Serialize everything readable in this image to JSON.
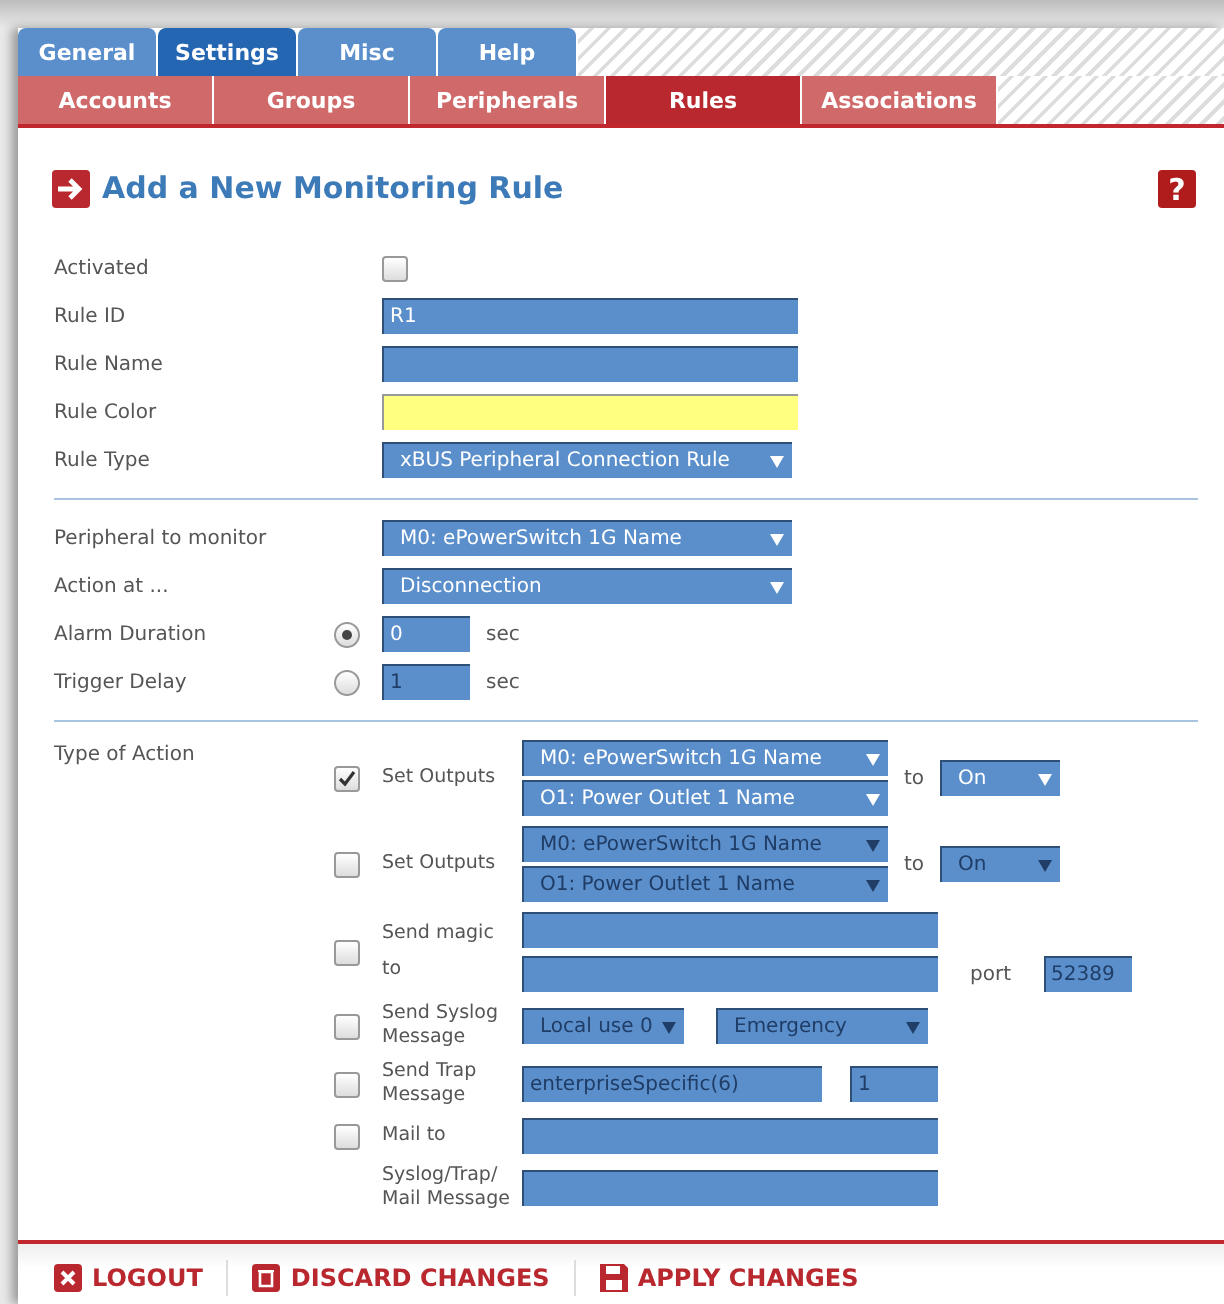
{
  "main_tabs": [
    {
      "label": "General",
      "selected": false
    },
    {
      "label": "Settings",
      "selected": true
    },
    {
      "label": "Misc",
      "selected": false
    },
    {
      "label": "Help",
      "selected": false
    }
  ],
  "sub_tabs": [
    {
      "label": "Accounts",
      "selected": false
    },
    {
      "label": "Groups",
      "selected": false
    },
    {
      "label": "Peripherals",
      "selected": false
    },
    {
      "label": "Rules",
      "selected": true
    },
    {
      "label": "Associations",
      "selected": false
    }
  ],
  "page": {
    "title": "Add a New Monitoring Rule",
    "help": "?"
  },
  "rule_fields": [
    {
      "kind": "checkbox",
      "label": "Activated",
      "checked": false
    },
    {
      "kind": "text",
      "label": "Rule ID",
      "value": "R1"
    },
    {
      "kind": "text",
      "label": "Rule Name"
    },
    {
      "kind": "color",
      "label": "Rule Color",
      "color": "#ffff80"
    },
    {
      "kind": "select",
      "label": "Rule Type",
      "value": "xBUS Peripheral Connection Rule"
    }
  ],
  "monitor_fields": [
    {
      "kind": "select",
      "label": "Peripheral to monitor",
      "value": "M0: ePowerSwitch 1G Name"
    },
    {
      "kind": "select",
      "label": "Action at ...",
      "value": "Disconnection"
    },
    {
      "kind": "duration",
      "label": "Alarm Duration",
      "selected": true,
      "value": "0",
      "unit": "sec"
    },
    {
      "kind": "duration",
      "label": "Trigger Delay",
      "selected": false,
      "value": "1",
      "unit": "sec"
    }
  ],
  "actions": {
    "label": "Type of Action",
    "items": [
      {
        "kind": "outputs",
        "checked": true,
        "label": "Set Outputs",
        "device": "M0: ePowerSwitch 1G Name",
        "outlet": "O1: Power Outlet 1 Name",
        "to_label": "to",
        "state": "On"
      },
      {
        "kind": "outputs",
        "checked": false,
        "label": "Set Outputs",
        "device": "M0: ePowerSwitch 1G Name",
        "outlet": "O1: Power Outlet 1 Name",
        "to_label": "to",
        "state": "On"
      },
      {
        "kind": "magic",
        "checked": false,
        "label": "Send magic",
        "to_label": "to",
        "port_label": "port",
        "port": "52389"
      },
      {
        "kind": "syslog",
        "checked": false,
        "label": "Send Syslog Message",
        "facility": "Local use 0",
        "severity": "Emergency"
      },
      {
        "kind": "trap",
        "checked": false,
        "label": "Send Trap Message",
        "trap_type": "enterpriseSpecific(6)",
        "trap_code": "1"
      },
      {
        "kind": "mail",
        "checked": false,
        "label": "Mail to"
      },
      {
        "kind": "message",
        "label": "Syslog/Trap/ Mail Message"
      }
    ]
  },
  "footer": [
    {
      "kind": "logout",
      "label": "LOGOUT"
    },
    {
      "kind": "discard",
      "label": "DISCARD CHANGES"
    },
    {
      "kind": "apply",
      "label": "APPLY CHANGES"
    }
  ]
}
